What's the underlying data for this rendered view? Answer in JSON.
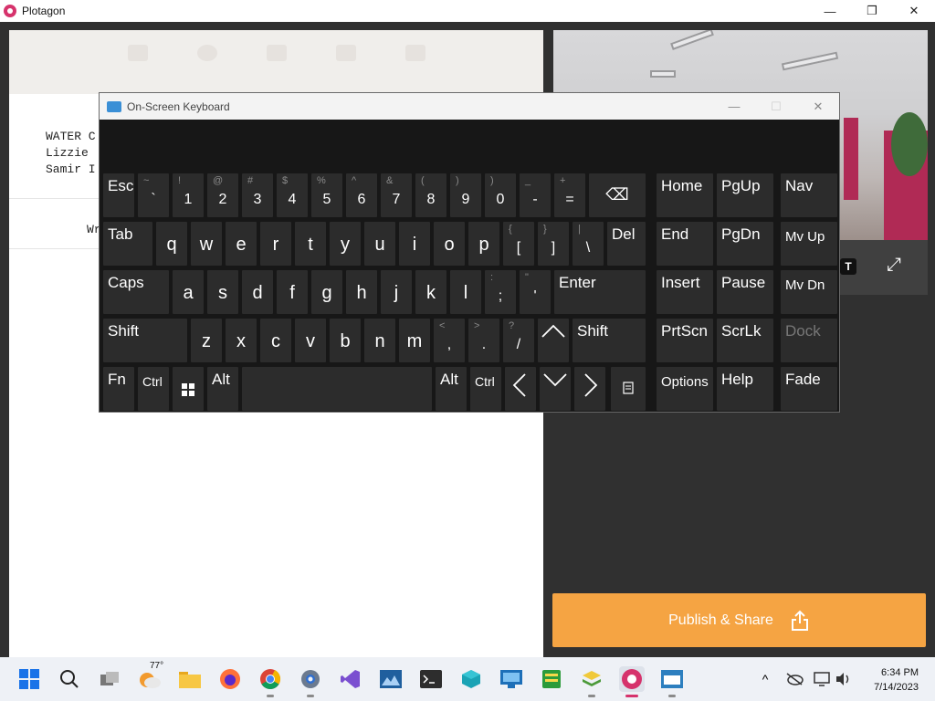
{
  "window": {
    "title": "Plotagon",
    "controls": {
      "minimize": "—",
      "maximize": "❐",
      "close": "✕"
    }
  },
  "script": {
    "scene_lines": [
      "WATER C",
      "Lizzie",
      "Samir I"
    ],
    "write_prompt": "Wr"
  },
  "publish": {
    "label": "Publish & Share"
  },
  "osk": {
    "title": "On-Screen Keyboard",
    "controls": {
      "minimize": "—",
      "maximize": "☐",
      "close": "✕"
    },
    "row1": {
      "esc": "Esc",
      "digits": [
        {
          "top": "~",
          "main": "`"
        },
        {
          "top": "!",
          "main": "1"
        },
        {
          "top": "@",
          "main": "2"
        },
        {
          "top": "#",
          "main": "3"
        },
        {
          "top": "$",
          "main": "4"
        },
        {
          "top": "%",
          "main": "5"
        },
        {
          "top": "^",
          "main": "6"
        },
        {
          "top": "&",
          "main": "7"
        },
        {
          "top": "(",
          "main": "8"
        },
        {
          "top": ")",
          "main": "9"
        },
        {
          "top": ")",
          "main": "0"
        },
        {
          "top": "_",
          "main": "-"
        },
        {
          "top": "+",
          "main": "="
        }
      ],
      "backspace": "⌫"
    },
    "row2": {
      "tab": "Tab",
      "letters": [
        "q",
        "w",
        "e",
        "r",
        "t",
        "y",
        "u",
        "i",
        "o",
        "p"
      ],
      "brackets": [
        {
          "top": "{",
          "main": "["
        },
        {
          "top": "}",
          "main": "]"
        },
        {
          "top": "|",
          "main": "\\"
        }
      ],
      "del": "Del"
    },
    "row3": {
      "caps": "Caps",
      "letters": [
        "a",
        "s",
        "d",
        "f",
        "g",
        "h",
        "j",
        "k",
        "l"
      ],
      "punct": [
        {
          "top": ":",
          "main": ";"
        },
        {
          "top": "\"",
          "main": "'"
        }
      ],
      "enter": "Enter"
    },
    "row4": {
      "shift_left": "Shift",
      "letters": [
        "z",
        "x",
        "c",
        "v",
        "b",
        "n",
        "m"
      ],
      "punct": [
        {
          "top": "<",
          "main": ","
        },
        {
          "top": ">",
          "main": "."
        },
        {
          "top": "?",
          "main": "/"
        }
      ],
      "up": "^",
      "shift_right": "Shift"
    },
    "row5": {
      "fn": "Fn",
      "ctrl_left": "Ctrl",
      "alt_left": "Alt",
      "alt_right": "Alt",
      "ctrl_right": "Ctrl"
    },
    "nav_keys": {
      "home": "Home",
      "pgup": "PgUp",
      "nav": "Nav",
      "end": "End",
      "pgdn": "PgDn",
      "mvup": "Mv Up",
      "insert": "Insert",
      "pause": "Pause",
      "mvdn": "Mv Dn",
      "prtscn": "PrtScn",
      "scrlk": "ScrLk",
      "dock": "Dock",
      "options": "Options",
      "help": "Help",
      "fade": "Fade"
    }
  },
  "taskbar": {
    "weather_temp": "77°",
    "clock_time": "6:34 PM",
    "clock_date": "7/14/2023"
  }
}
